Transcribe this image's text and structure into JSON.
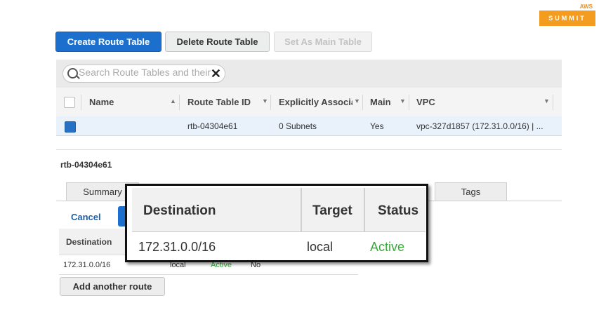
{
  "brand": {
    "aws": "AWS",
    "summit": "SUMMIT",
    "accent": "#f39c1f"
  },
  "toolbar": {
    "create_label": "Create Route Table",
    "delete_label": "Delete Route Table",
    "set_main_label": "Set As Main Table"
  },
  "search": {
    "placeholder": "Search Route Tables and their"
  },
  "table": {
    "columns": [
      "Name",
      "Route Table ID",
      "Explicitly Associat",
      "Main",
      "VPC"
    ],
    "rows": [
      {
        "name": "",
        "id": "rtb-04304e61",
        "assoc": "0 Subnets",
        "main": "Yes",
        "vpc": "vpc-327d1857 (172.31.0.0/16) | ..."
      }
    ]
  },
  "detail": {
    "title": "rtb-04304e61",
    "tabs": [
      "Summary",
      "Tags"
    ],
    "cancel_label": "Cancel",
    "routes_header": "Destination",
    "route_row": {
      "destination": "172.31.0.0/16",
      "target": "local",
      "status": "Active",
      "propagated": "No"
    },
    "add_route_label": "Add another route"
  },
  "callout": {
    "headers": [
      "Destination",
      "Target",
      "Status"
    ],
    "row": {
      "destination": "172.31.0.0/16",
      "target": "local",
      "status": "Active"
    },
    "status_color": "#3aa83a"
  }
}
